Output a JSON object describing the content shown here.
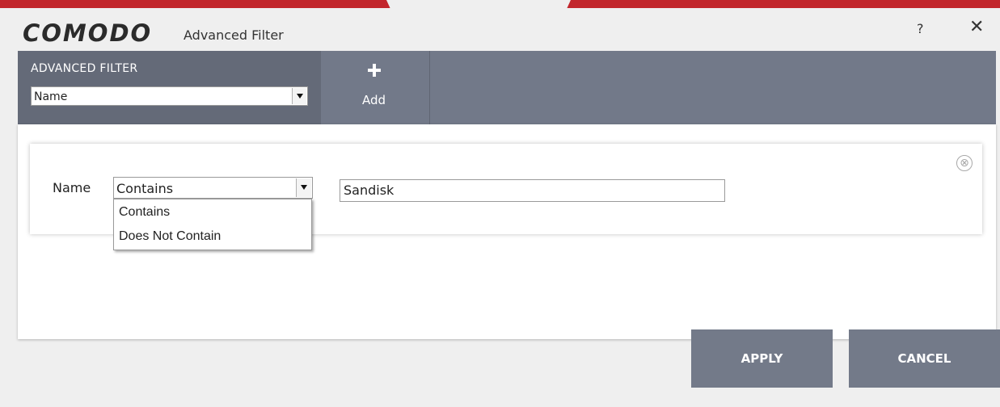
{
  "app": {
    "logo_text": "COMODO",
    "window_title": "Advanced Filter"
  },
  "titlebar": {
    "help_label": "?",
    "close_label": "✕"
  },
  "toolbar": {
    "filter_heading": "ADVANCED FILTER",
    "filter_select_value": "Name",
    "add_label": "Add"
  },
  "condition": {
    "field_label": "Name",
    "operator_value": "Contains",
    "operator_options": [
      "Contains",
      "Does Not Contain"
    ],
    "value": "Sandisk",
    "remove_icon": "⊗"
  },
  "footer": {
    "apply_label": "APPLY",
    "cancel_label": "CANCEL"
  },
  "colors": {
    "brand_red": "#c2262c",
    "toolbar": "#727989",
    "toolbar_dark": "#646a78"
  }
}
